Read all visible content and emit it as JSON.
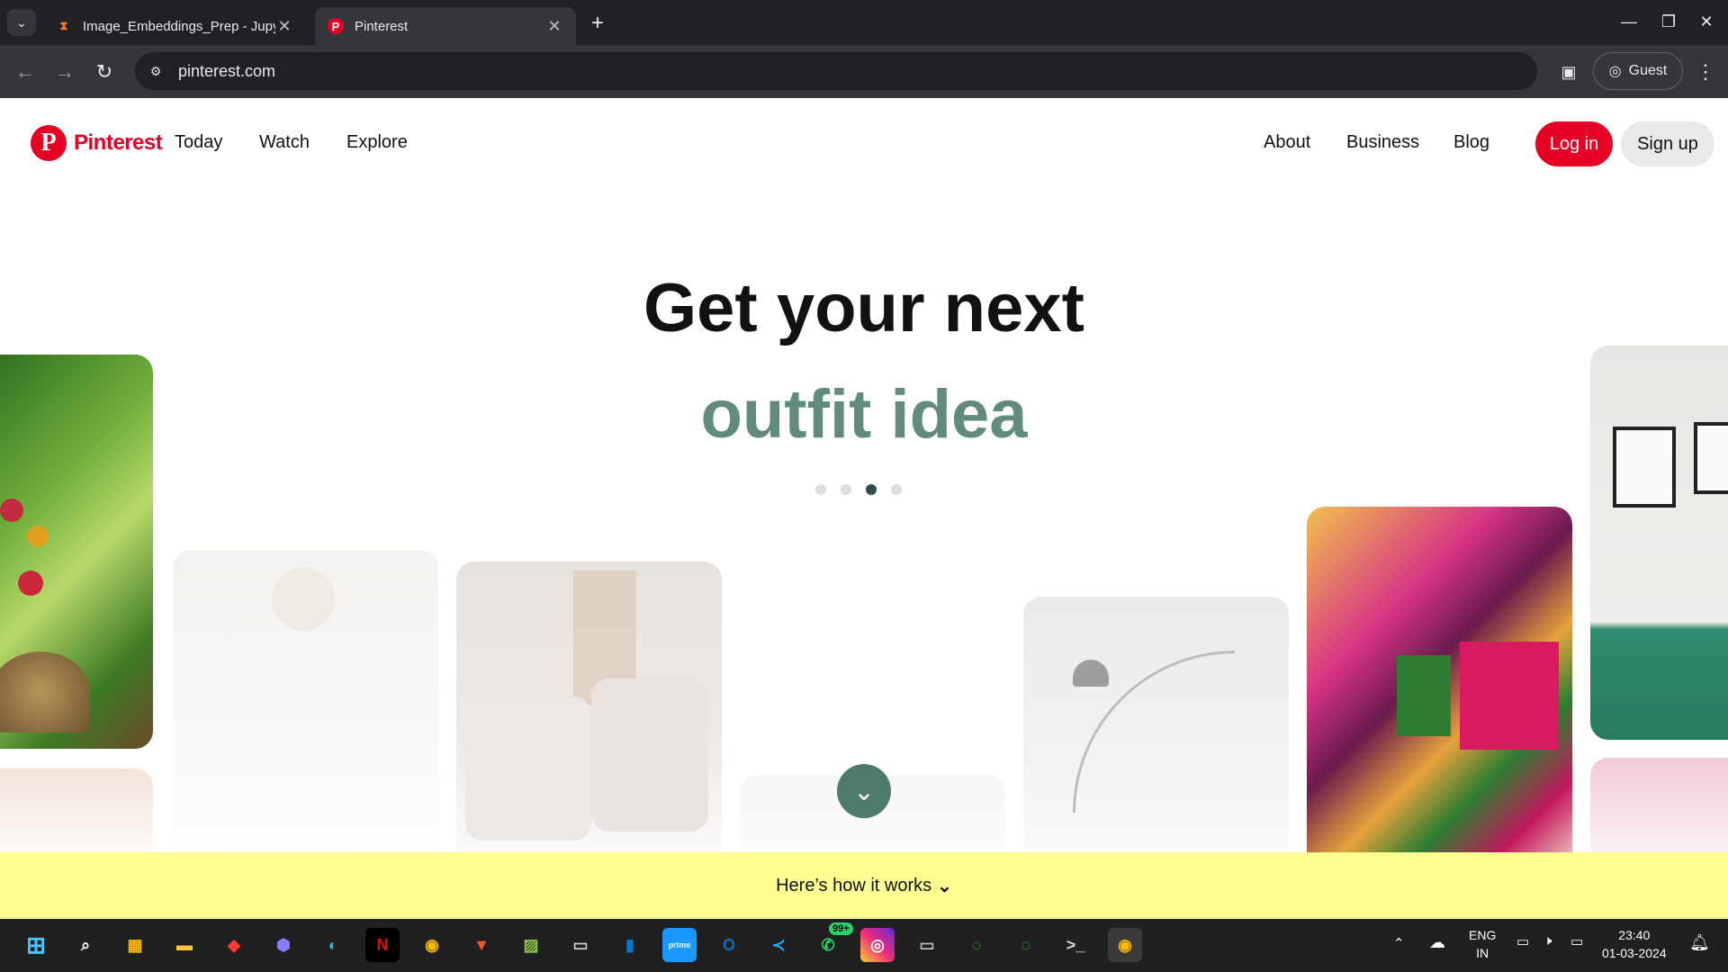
{
  "browser": {
    "tabs": [
      {
        "title": "Image_Embeddings_Prep - Jupy",
        "favicon": "hourglass-icon"
      },
      {
        "title": "Pinterest",
        "favicon": "pinterest-icon"
      }
    ],
    "url": "pinterest.com",
    "profile_label": "Guest"
  },
  "header": {
    "logo_text": "Pinterest",
    "left_nav": [
      "Today",
      "Watch",
      "Explore"
    ],
    "right_nav": [
      "About",
      "Business",
      "Blog"
    ],
    "login_label": "Log in",
    "signup_label": "Sign up"
  },
  "hero": {
    "headline": "Get your next",
    "subline": "outfit idea",
    "active_dot": 3,
    "dot_count": 4,
    "accent_color": "#618c7b"
  },
  "footer_bar": {
    "label": "Here’s how it works"
  },
  "taskbar": {
    "apps": [
      "start-icon",
      "search-icon",
      "store-icon",
      "file-explorer-icon",
      "app-icon",
      "copilot-icon",
      "edge-icon",
      "netflix-icon",
      "chrome-icon",
      "brave-icon",
      "photos-icon",
      "terminal-icon",
      "windows-app-icon",
      "prime-video-icon",
      "outlook-icon",
      "vscode-icon",
      "whatsapp-icon",
      "instagram-icon",
      "console-icon",
      "spinner-icon",
      "spinner-icon",
      "terminal-icon",
      "chrome-icon"
    ],
    "whatsapp_badge": "99+",
    "language": "ENG",
    "region": "IN",
    "time": "23:40",
    "date": "01-03-2024"
  },
  "colors": {
    "brand": "#e60023",
    "howbar": "#fffd92",
    "scroll_button": "#4f7b6b"
  }
}
